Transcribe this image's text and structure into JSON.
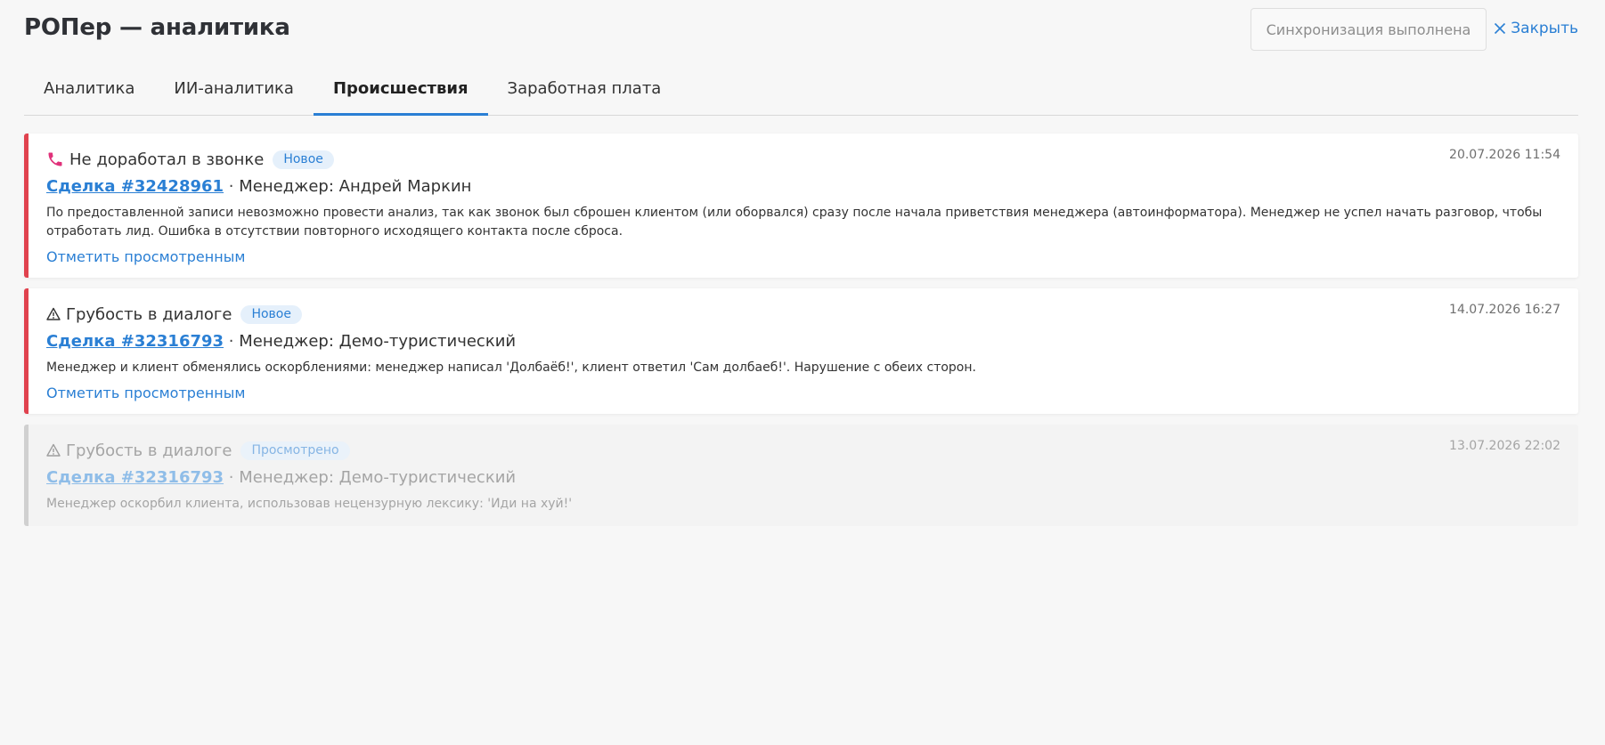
{
  "header": {
    "title": "РОПер — аналитика",
    "sync_label": "Синхронизация выполнена",
    "close_label": "Закрыть"
  },
  "tabs": [
    {
      "label": "Аналитика",
      "active": false
    },
    {
      "label": "ИИ-аналитика",
      "active": false
    },
    {
      "label": "Происшествия",
      "active": true
    },
    {
      "label": "Заработная плата",
      "active": false
    }
  ],
  "incidents": [
    {
      "icon": "phone-icon",
      "type": "Не доработал в звонке",
      "status": "Новое",
      "date": "20.07.2026 11:54",
      "deal": "Сделка #32428961",
      "manager": "Менеджер: Андрей Маркин",
      "description": "По предоставленной записи невозможно провести анализ, так как звонок был сброшен клиентом (или оборвался) сразу после начала приветствия менеджера (автоинформатора). Менеджер не успел начать разговор, чтобы отработать лид. Ошибка в отсутствии повторного исходящего контакта после сброса.",
      "action": "Отметить просмотренным"
    },
    {
      "icon": "warning-icon",
      "type": "Грубость в диалоге",
      "status": "Новое",
      "date": "14.07.2026 16:27",
      "deal": "Сделка #32316793",
      "manager": "Менеджер: Демо-туристический",
      "description": "Менеджер и клиент обменялись оскорблениями: менеджер написал 'Долбаёб!', клиент ответил 'Сам долбаеб!'. Нарушение с обеих сторон.",
      "action": "Отметить просмотренным"
    },
    {
      "icon": "warning-icon",
      "type": "Грубость в диалоге",
      "status": "Просмотрено",
      "date": "13.07.2026 22:02",
      "deal": "Сделка #32316793",
      "manager": "Менеджер: Демо-туристический",
      "description": "Менеджер оскорбил клиента, использовав нецензурную лексику: 'Иди на хуй!'"
    }
  ],
  "separator": "·",
  "colors": {
    "accent": "#2a7fd4",
    "alert": "#e0424e",
    "viewed_border": "#d0d0d0",
    "phone_icon": "#e0317a"
  }
}
